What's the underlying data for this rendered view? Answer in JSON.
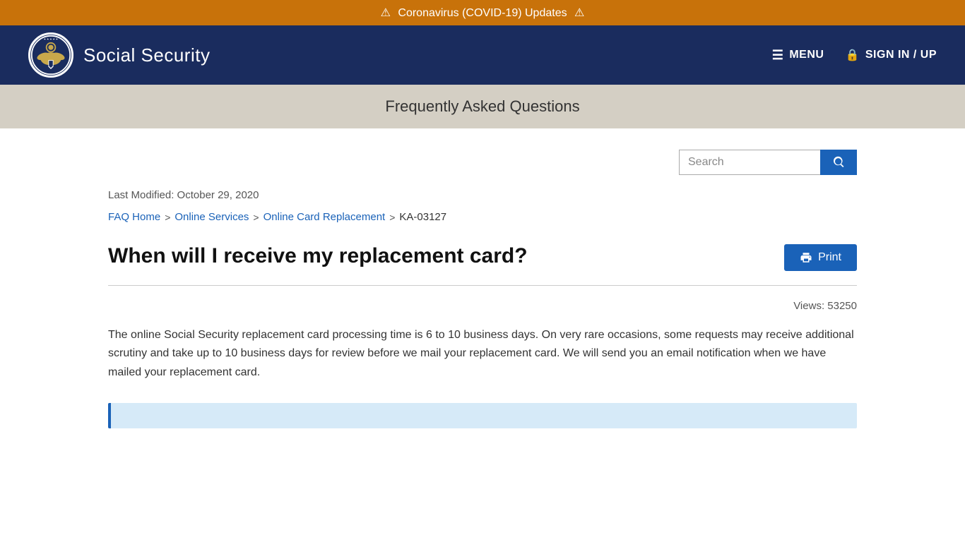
{
  "alert": {
    "icon_left": "⚠",
    "text": "Coronavirus (COVID-19) Updates",
    "icon_right": "⚠"
  },
  "header": {
    "site_name": "Social Security",
    "menu_label": "MENU",
    "signin_label": "SIGN IN / UP"
  },
  "page_subtitle": "Frequently Asked Questions",
  "search": {
    "placeholder": "Search"
  },
  "article": {
    "last_modified": "Last Modified: October 29, 2020",
    "breadcrumb": {
      "faq_home": "FAQ Home",
      "online_services": "Online Services",
      "online_card_replacement": "Online Card Replacement",
      "article_id": "KA-03127"
    },
    "title": "When will I receive my replacement card?",
    "print_label": "Print",
    "views": "Views: 53250",
    "body": "The online Social Security replacement card processing time is 6 to 10 business days. On very rare occasions, some requests may receive additional scrutiny and take up to 10 business days for review before we mail your replacement card. We will send you an email notification when we have mailed your replacement card."
  }
}
